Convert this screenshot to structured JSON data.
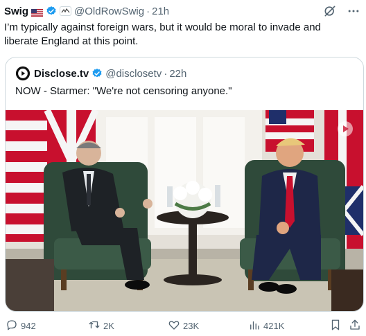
{
  "post": {
    "author_name": "Swig",
    "handle": "@OldRowSwig",
    "separator": "·",
    "time": "21h",
    "text": "I’m typically against foreign wars, but it would be moral to invade and liberate England at this point."
  },
  "quoted_post": {
    "author_name": "Disclose.tv",
    "handle": "@disclosetv",
    "separator": "·",
    "time": "22h",
    "text": "NOW - Starmer: \"We're not censoring anyone.\""
  },
  "actions": {
    "replies": "942",
    "reposts": "2K",
    "likes": "23K",
    "views": "421K"
  },
  "icons": [
    "us-flag-icon",
    "verified-icon",
    "org-badge-icon",
    "grok-icon",
    "more-icon",
    "disclose-logo-icon",
    "reply-icon",
    "repost-icon",
    "like-icon",
    "views-icon",
    "bookmark-icon",
    "share-icon"
  ],
  "colors": {
    "verified": "#1d9bf0",
    "text": "#0f1419",
    "secondary": "#536471",
    "border": "#cfd9de"
  }
}
